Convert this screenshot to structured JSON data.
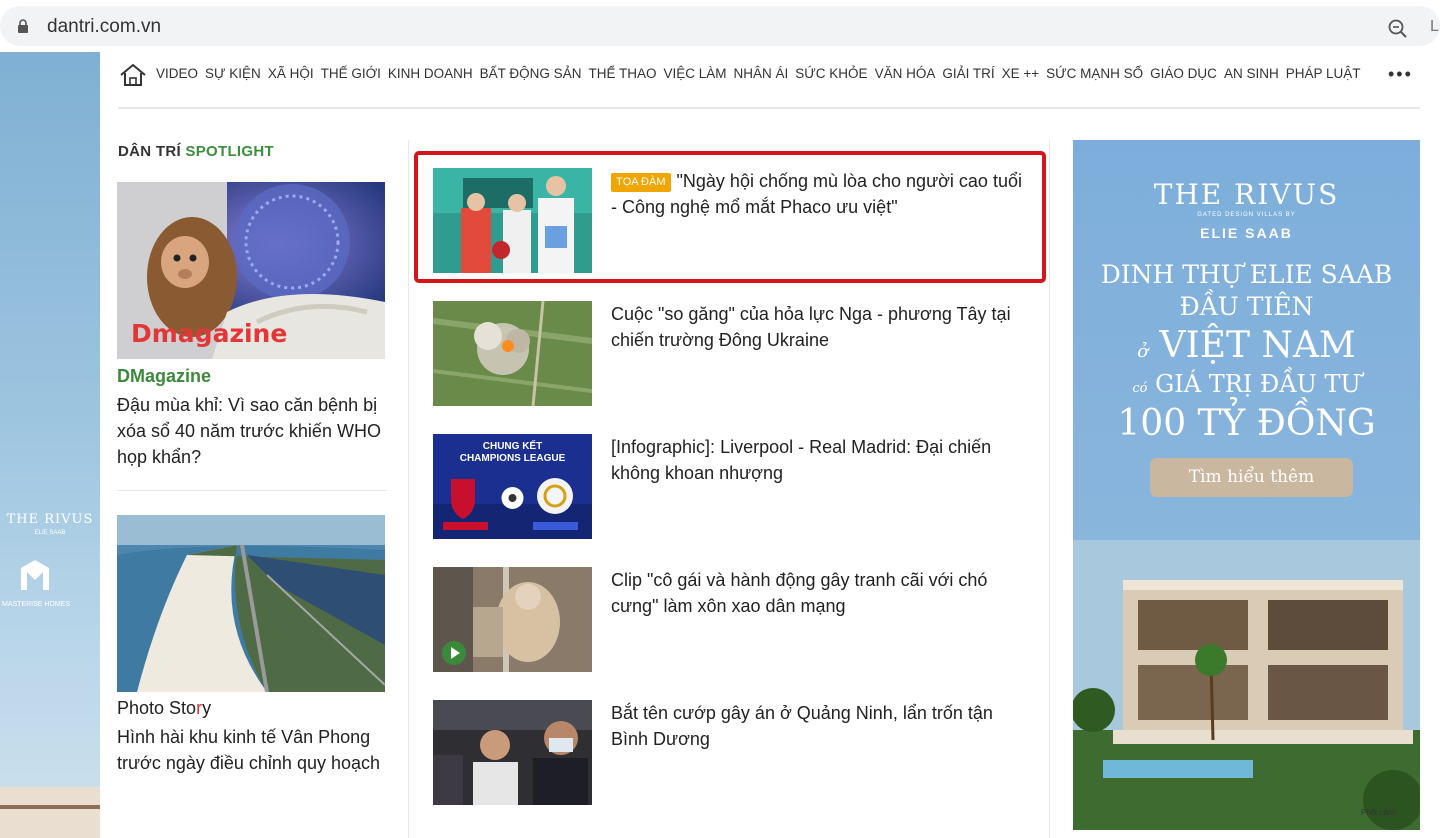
{
  "browser": {
    "url": "dantri.com.vn",
    "ext_partial": "Li"
  },
  "nav": {
    "items": [
      "VIDEO",
      "SỰ KIỆN",
      "XÃ HỘI",
      "THẾ GIỚI",
      "KINH DOANH",
      "BẤT ĐỘNG SẢN",
      "THỂ THAO",
      "VIỆC LÀM",
      "NHÂN ÁI",
      "SỨC KHỎE",
      "VĂN HÓA",
      "GIẢI TRÍ",
      "XE ++",
      "SỨC MẠNH SỐ",
      "GIÁO DỤC",
      "AN SINH",
      "PHÁP LUẬT"
    ],
    "more": "•••"
  },
  "spotlight": {
    "head_a": "DÂN TRÍ",
    "head_b": "SPOTLIGHT",
    "item1": {
      "image_text": "Dmagazine",
      "label": "DMagazine",
      "title": "Đậu mùa khỉ: Vì sao căn bệnh bị xóa sổ 40 năm trước khiến WHO họp khẩn?"
    },
    "item2": {
      "label_a": "Photo Sto",
      "label_r": "r",
      "label_b": "y",
      "title": "Hình hài khu kinh tế Vân Phong trước ngày điều chỉnh quy hoạch"
    }
  },
  "articles": [
    {
      "tag": "TỌA ĐÀM",
      "title": "\"Ngày hội chống mù lòa cho người cao tuổi - Công nghệ mổ mắt Phaco ưu việt\""
    },
    {
      "tag": "",
      "title": "Cuộc \"so găng\" của hỏa lực Nga - phương Tây tại chiến trường Đông Ukraine"
    },
    {
      "tag": "",
      "title": "[Infographic]: Liverpool - Real Madrid: Đại chiến không khoan nhượng",
      "thumb_text1": "CHUNG KẾT",
      "thumb_text2": "CHAMPIONS LEAGUE"
    },
    {
      "tag": "",
      "title": "Clip \"cô gái và hành động gây tranh cãi với chó cưng\" làm xôn xao dân mạng"
    },
    {
      "tag": "",
      "title": "Bắt tên cướp gây án ở Quảng Ninh, lẩn trốn tận Bình Dương"
    }
  ],
  "left_banner": {
    "brand": "THE RIVUS",
    "sub": "ELIE SAAB",
    "company": "MASTERISE HOMES"
  },
  "ad": {
    "brand": "THE RIVUS",
    "tagline": "GATED DESIGN VILLAS BY",
    "brand2": "ELIE SAAB",
    "line1": "DINH THỰ ELIE SAAB",
    "line2": "ĐẦU TIÊN",
    "line3_small": "ở",
    "line3": "VIỆT NAM",
    "line4_small": "có",
    "line4": "GIÁ TRỊ ĐẦU TƯ",
    "line5": "100 TỶ ĐỒNG",
    "button": "Tìm hiểu thêm",
    "credit": "Phối cảnh"
  },
  "colors": {
    "accent_green": "#3b8f3b",
    "tag_orange": "#f0a500",
    "highlight_red": "#d4161c",
    "ad_blue": "#7daedb"
  }
}
